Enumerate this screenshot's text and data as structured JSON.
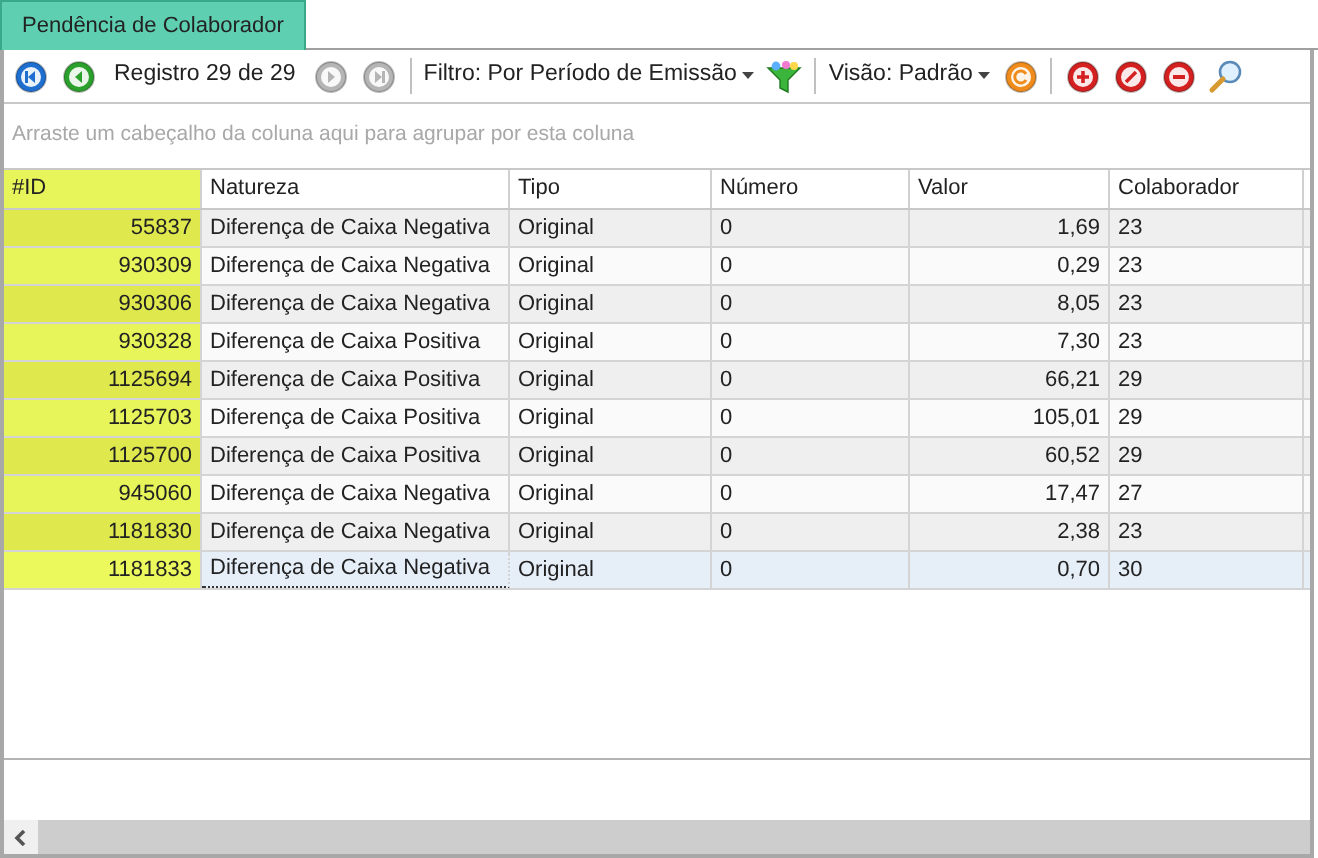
{
  "tab": {
    "label": "Pendência de Colaborador",
    "selected": true
  },
  "toolbar": {
    "nav_buttons": [
      {
        "kind": "first",
        "disabled": false
      },
      {
        "kind": "previous",
        "disabled": false
      },
      {
        "kind": "next",
        "disabled": true
      },
      {
        "kind": "last",
        "disabled": true
      }
    ],
    "record_label": "Registro 29 de 29",
    "filter_label": "Filtro: Por Período de Emissão",
    "view_label": "Visão: Padrão"
  },
  "group_panel": {
    "placeholder": "Arraste um cabeçalho da coluna aqui para agrupar por esta coluna"
  },
  "table": {
    "columns": [
      "#ID",
      "Natureza",
      "Tipo",
      "Número",
      "Valor",
      "Colaborador"
    ],
    "rows": [
      {
        "cells": [
          "55837",
          "Diferença de Caixa Negativa",
          "Original",
          "0",
          "1,69",
          "23"
        ],
        "selected": false
      },
      {
        "cells": [
          "930309",
          "Diferença de Caixa Negativa",
          "Original",
          "0",
          "0,29",
          "23"
        ],
        "selected": false
      },
      {
        "cells": [
          "930306",
          "Diferença de Caixa Negativa",
          "Original",
          "0",
          "8,05",
          "23"
        ],
        "selected": false
      },
      {
        "cells": [
          "930328",
          "Diferença de Caixa Positiva",
          "Original",
          "0",
          "7,30",
          "23"
        ],
        "selected": false
      },
      {
        "cells": [
          "1125694",
          "Diferença de Caixa Positiva",
          "Original",
          "0",
          "66,21",
          "29"
        ],
        "selected": false
      },
      {
        "cells": [
          "1125703",
          "Diferença de Caixa Positiva",
          "Original",
          "0",
          "105,01",
          "29"
        ],
        "selected": false
      },
      {
        "cells": [
          "1125700",
          "Diferença de Caixa Positiva",
          "Original",
          "0",
          "60,52",
          "29"
        ],
        "selected": false
      },
      {
        "cells": [
          "945060",
          "Diferença de Caixa Negativa",
          "Original",
          "0",
          "17,47",
          "27"
        ],
        "selected": false
      },
      {
        "cells": [
          "1181830",
          "Diferença de Caixa Negativa",
          "Original",
          "0",
          "2,38",
          "23"
        ],
        "selected": false
      },
      {
        "cells": [
          "1181833",
          "Diferença de Caixa Negativa",
          "Original",
          "0",
          "0,70",
          "30"
        ],
        "selected": true
      }
    ]
  }
}
